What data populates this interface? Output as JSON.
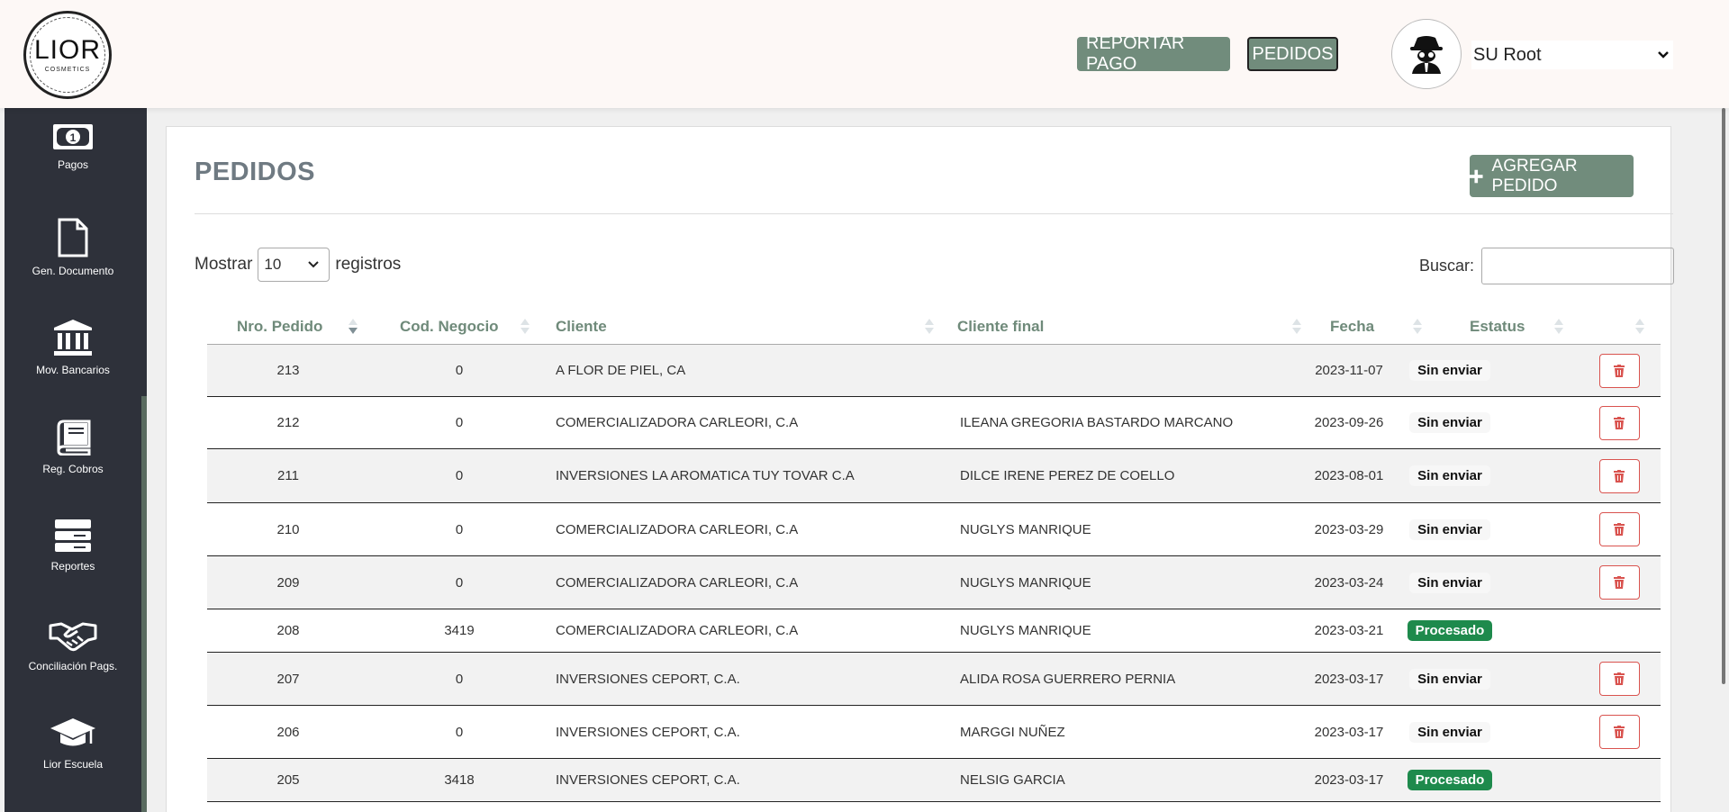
{
  "brand": {
    "logo_main": "LIOR",
    "logo_sub": "COSMETICS"
  },
  "header": {
    "reportar_label": "REPORTAR PAGO",
    "pedidos_label": "PEDIDOS",
    "user_name": "SU Root"
  },
  "sidebar": {
    "items": [
      {
        "label": "Pagos",
        "icon": "banknote-icon"
      },
      {
        "label": "Gen. Documento",
        "icon": "document-icon"
      },
      {
        "label": "Mov. Bancarios",
        "icon": "bank-icon"
      },
      {
        "label": "Reg. Cobros",
        "icon": "book-icon"
      },
      {
        "label": "Reportes",
        "icon": "server-icon"
      },
      {
        "label": "Conciliación Pags.",
        "icon": "handshake-icon"
      },
      {
        "label": "Lior Escuela",
        "icon": "graduation-cap-icon"
      }
    ]
  },
  "page": {
    "title": "PEDIDOS",
    "add_label": "AGREGAR PEDIDO",
    "show_prefix": "Mostrar",
    "show_value": "10",
    "show_suffix": "registros",
    "search_label": "Buscar:",
    "search_value": ""
  },
  "table": {
    "columns": [
      "Nro. Pedido",
      "Cod. Negocio",
      "Cliente",
      "Cliente final",
      "Fecha",
      "Estatus"
    ],
    "rows": [
      {
        "nro": "213",
        "cod": "0",
        "cliente": "A FLOR DE PIEL, CA",
        "final": "",
        "fecha": "2023-11-07",
        "estatus": "Sin enviar"
      },
      {
        "nro": "212",
        "cod": "0",
        "cliente": "COMERCIALIZADORA CARLEORI, C.A",
        "final": "ILEANA GREGORIA BASTARDO MARCANO",
        "fecha": "2023-09-26",
        "estatus": "Sin enviar"
      },
      {
        "nro": "211",
        "cod": "0",
        "cliente": "INVERSIONES LA AROMATICA TUY TOVAR C.A",
        "final": "DILCE IRENE PEREZ DE COELLO",
        "fecha": "2023-08-01",
        "estatus": "Sin enviar"
      },
      {
        "nro": "210",
        "cod": "0",
        "cliente": "COMERCIALIZADORA CARLEORI, C.A",
        "final": "NUGLYS MANRIQUE",
        "fecha": "2023-03-29",
        "estatus": "Sin enviar"
      },
      {
        "nro": "209",
        "cod": "0",
        "cliente": "COMERCIALIZADORA CARLEORI, C.A",
        "final": "NUGLYS MANRIQUE",
        "fecha": "2023-03-24",
        "estatus": "Sin enviar"
      },
      {
        "nro": "208",
        "cod": "3419",
        "cliente": "COMERCIALIZADORA CARLEORI, C.A",
        "final": "NUGLYS MANRIQUE",
        "fecha": "2023-03-21",
        "estatus": "Procesado"
      },
      {
        "nro": "207",
        "cod": "0",
        "cliente": "INVERSIONES CEPORT, C.A.",
        "final": "ALIDA ROSA GUERRERO PERNIA",
        "fecha": "2023-03-17",
        "estatus": "Sin enviar"
      },
      {
        "nro": "206",
        "cod": "0",
        "cliente": "INVERSIONES CEPORT, C.A.",
        "final": "MARGGI NUÑEZ",
        "fecha": "2023-03-17",
        "estatus": "Sin enviar"
      },
      {
        "nro": "205",
        "cod": "3418",
        "cliente": "INVERSIONES CEPORT, C.A.",
        "final": "NELSIG GARCIA",
        "fecha": "2023-03-17",
        "estatus": "Procesado"
      }
    ]
  },
  "colors": {
    "accent": "#718c7c",
    "sidebar": "#2e313a",
    "processed": "#1e8a4c",
    "danger": "#d9534f"
  }
}
